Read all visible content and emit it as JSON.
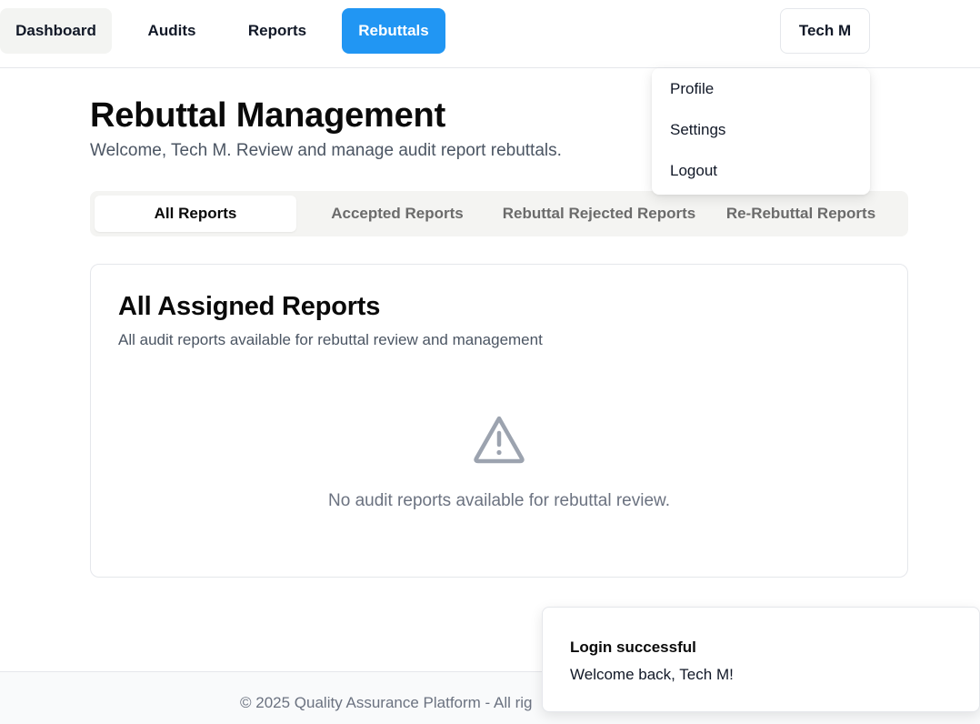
{
  "nav": {
    "items": [
      {
        "label": "Dashboard",
        "active": false
      },
      {
        "label": "Audits",
        "active": false
      },
      {
        "label": "Reports",
        "active": false
      },
      {
        "label": "Rebuttals",
        "active": true
      }
    ],
    "user_label": "Tech M",
    "accent_color": "#2196f3"
  },
  "user_menu": {
    "items": [
      {
        "label": "Profile"
      },
      {
        "label": "Settings"
      },
      {
        "label": "Logout"
      }
    ]
  },
  "header": {
    "title": "Rebuttal Management",
    "subtitle": "Welcome, Tech M. Review and manage audit report rebuttals."
  },
  "tabs": [
    {
      "label": "All Reports",
      "selected": true
    },
    {
      "label": "Accepted Reports",
      "selected": false
    },
    {
      "label": "Rebuttal Rejected Reports",
      "selected": false
    },
    {
      "label": "Re-Rebuttal Reports",
      "selected": false
    }
  ],
  "card": {
    "title": "All Assigned Reports",
    "description": "All audit reports available for rebuttal review and management",
    "empty_icon": "alert-triangle-icon",
    "empty_message": "No audit reports available for rebuttal review."
  },
  "footer": {
    "text": "© 2025 Quality Assurance Platform - All rig"
  },
  "toast": {
    "title": "Login successful",
    "message": "Welcome back, Tech M!"
  }
}
